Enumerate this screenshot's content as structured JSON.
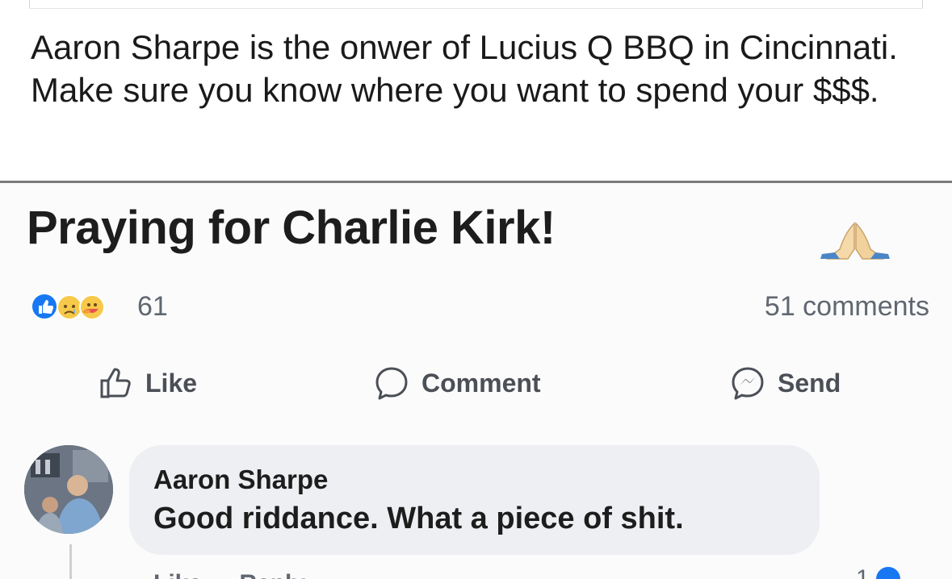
{
  "caption": {
    "text": "Aaron Sharpe is the onwer of Lucius Q BBQ in Cincinnati. Make sure you know where you want to spend your $$$."
  },
  "post": {
    "title": "Praying for Charlie Kirk!",
    "title_emoji_icon": "folded-hands-icon",
    "reaction_icons": [
      "like-icon",
      "sad-icon",
      "care-icon"
    ],
    "reaction_count": "61",
    "comments_count": "51 comments",
    "actions": [
      {
        "label": "Like",
        "icon": "thumbs-up-icon"
      },
      {
        "label": "Comment",
        "icon": "comment-bubble-icon"
      },
      {
        "label": "Send",
        "icon": "messenger-icon"
      }
    ]
  },
  "comment": {
    "author": "Aaron Sharpe",
    "text": "Good riddance. What a piece of shit.",
    "actions": [
      "Like",
      "Reply"
    ],
    "reaction_count": "1"
  },
  "colors": {
    "facebook_blue": "#1877f2",
    "text_dark": "#1d1d1d",
    "text_grey": "#606770",
    "bubble_bg": "#eeeff2"
  }
}
